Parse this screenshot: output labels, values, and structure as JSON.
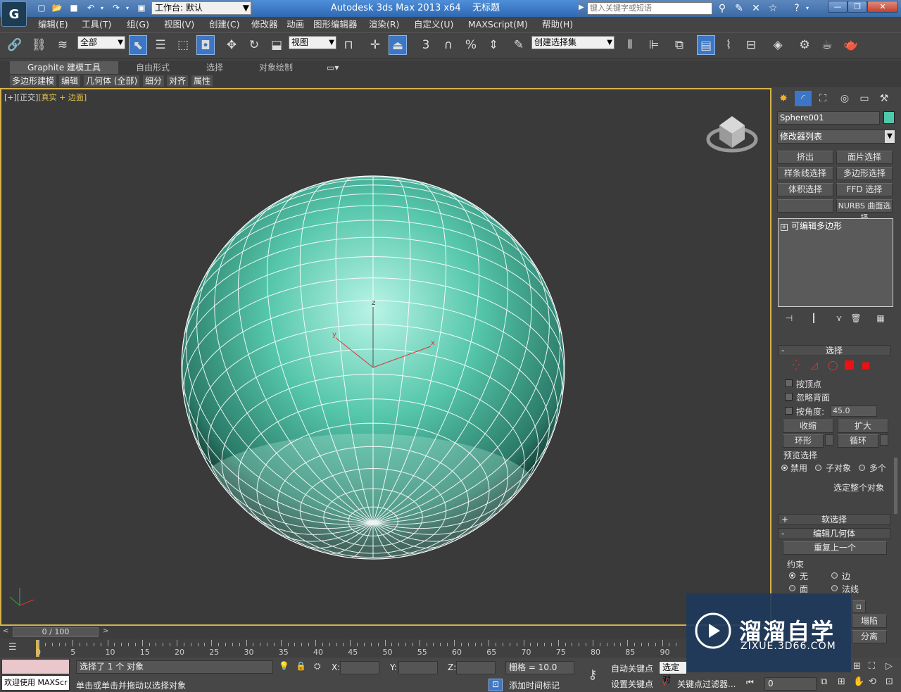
{
  "titlebar": {
    "workspace_label": "工作台: 默认",
    "app_title": "Autodesk 3ds Max  2013 x64",
    "doc_title": "无标题",
    "search_placeholder": "键入关键字或短语"
  },
  "menu": {
    "items": [
      "编辑(E)",
      "工具(T)",
      "组(G)",
      "视图(V)",
      "创建(C)",
      "修改器",
      "动画",
      "图形编辑器",
      "渲染(R)",
      "自定义(U)",
      "MAXScript(M)",
      "帮助(H)"
    ]
  },
  "toolbar": {
    "filter": "全部",
    "ref_coord": "视图",
    "selection_set": "创建选择集",
    "snap_3": "3",
    "snap_pct": "%"
  },
  "ribbon": {
    "tabs": [
      "Graphite 建模工具",
      "自由形式",
      "选择",
      "对象绘制"
    ],
    "subtabs": [
      "多边形建模",
      "编辑",
      "几何体 (全部)",
      "细分",
      "对齐",
      "属性"
    ]
  },
  "viewport": {
    "label_prefix": "[+][正交]",
    "label_mode": "[真实 + 边面]",
    "axis_x": "x",
    "axis_y": "y",
    "axis_z": "z",
    "object_color": "#4fc9a9"
  },
  "command_panel": {
    "object_name": "Sphere001",
    "object_color": "#4fc9a9",
    "modifier_list": "修改器列表",
    "mod_buttons": [
      "挤出",
      "面片选择",
      "样条线选择",
      "多边形选择",
      "体积选择",
      "FFD 选择",
      "",
      "NURBS 曲面选择"
    ],
    "stack_item": "可编辑多边形",
    "rollouts": {
      "selection": {
        "title": "选择",
        "by_vertex": "按顶点",
        "ignore_backfacing": "忽略背面",
        "by_angle": "按角度:",
        "angle_value": "45.0",
        "shrink": "收缩",
        "grow": "扩大",
        "ring": "环形",
        "loop": "循环",
        "preview_title": "预览选择",
        "preview_off": "禁用",
        "preview_sub": "子对象",
        "preview_multi": "多个",
        "select_whole": "选定整个对象"
      },
      "soft_selection": {
        "title": "软选择"
      },
      "edit_geometry": {
        "title": "编辑几何体",
        "repeat_last": "重复上一个",
        "constraints": "约束",
        "c_none": "无",
        "c_edge": "边",
        "c_face": "面",
        "c_normal": "法线",
        "collapse": "塌陷",
        "detach": "分离"
      }
    }
  },
  "timeline": {
    "frame_display": "0 / 100",
    "ticks": [
      "0",
      "5",
      "10",
      "15",
      "20",
      "25",
      "30",
      "35",
      "40",
      "45",
      "50",
      "55",
      "60",
      "65",
      "70",
      "75",
      "80",
      "85",
      "90"
    ]
  },
  "status": {
    "maxscript_listener": "欢迎使用 MAXScr",
    "selected_text": "选择了 1 个 对象",
    "prompt_text": "单击或单击并拖动以选择对象",
    "x_label": "X:",
    "y_label": "Y:",
    "z_label": "Z:",
    "grid_text": "栅格 = 10.0",
    "auto_key": "自动关键点",
    "set_key": "设置关键点",
    "selected_dropdown": "选定对",
    "key_filters": "关键点过滤器...",
    "add_time_tag": "添加时间标记",
    "frame_value": "0"
  },
  "watermark": {
    "brand": "溜溜自学",
    "url": "ZIXUE.3D66.COM"
  }
}
